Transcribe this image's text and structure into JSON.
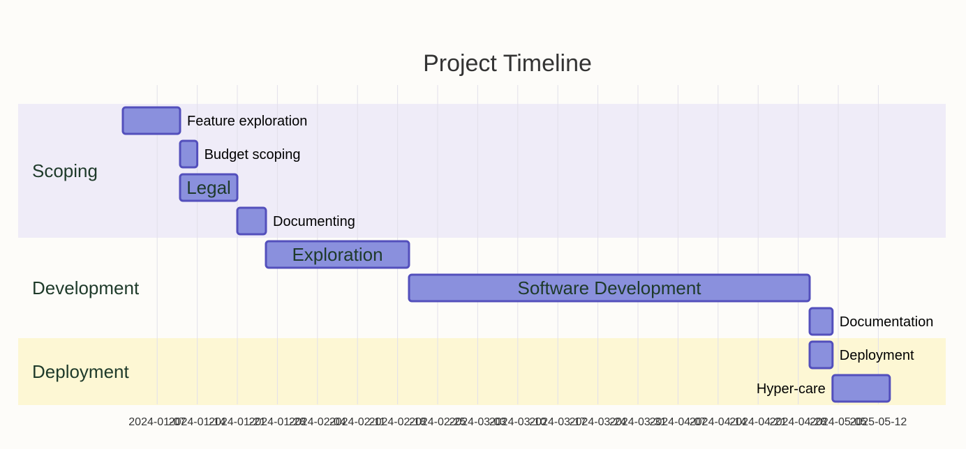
{
  "title": "Project Timeline",
  "colors": {
    "background": "#fdfcf9",
    "section_scoping_bg": "#efecf8",
    "section_development_bg": "#fdfcf9",
    "section_deployment_bg": "#fdf7d4",
    "bar_fill": "#8a90dd",
    "bar_stroke": "#534fbc",
    "section_label": "#1e3a2a",
    "grid": "#e2e0ea"
  },
  "chart_data": {
    "type": "gantt",
    "title": "Project Timeline",
    "x_axis": "date",
    "x_ticks": [
      "2024-01-07",
      "2024-01-14",
      "2024-01-21",
      "2024-01-28",
      "2024-02-04",
      "2024-02-11",
      "2024-02-18",
      "2024-02-25",
      "2024-03-03",
      "2024-03-10",
      "2024-03-17",
      "2024-03-24",
      "2024-03-31",
      "2024-04-07",
      "2024-04-14",
      "2024-04-21",
      "2024-04-28",
      "2024-05-05",
      "2024-05-12"
    ],
    "x_tick_labels": [
      "2024-01-07",
      "2024-01-14",
      "2024-01-21",
      "2024-01-28",
      "2024-02-04",
      "2024-02-11",
      "2024-02-18",
      "2024-02-25",
      "2024-03-03",
      "2024-03-10",
      "2024-03-17",
      "2024-03-24",
      "2024-03-31",
      "2024-04-07",
      "2024-04-14",
      "2024-04-21",
      "2024-04-28",
      "2024-05-05",
      "2025-05-12"
    ],
    "x_range": [
      "2024-01-01",
      "2024-05-13"
    ],
    "sections": [
      {
        "name": "Scoping",
        "tasks": [
          {
            "name": "Feature exploration",
            "start": "2024-01-01",
            "end": "2024-01-11",
            "label_inside": false
          },
          {
            "name": "Budget scoping",
            "start": "2024-01-11",
            "end": "2024-01-14",
            "label_inside": false
          },
          {
            "name": "Legal",
            "start": "2024-01-11",
            "end": "2024-01-21",
            "label_inside": true
          },
          {
            "name": "Documenting",
            "start": "2024-01-21",
            "end": "2024-01-26",
            "label_inside": false
          }
        ]
      },
      {
        "name": "Development",
        "tasks": [
          {
            "name": "Exploration",
            "start": "2024-01-26",
            "end": "2024-02-20",
            "label_inside": true
          },
          {
            "name": "Software Development",
            "start": "2024-02-20",
            "end": "2024-04-30",
            "label_inside": true
          },
          {
            "name": "Documentation",
            "start": "2024-04-30",
            "end": "2024-05-04",
            "label_inside": false
          }
        ]
      },
      {
        "name": "Deployment",
        "tasks": [
          {
            "name": "Deployment",
            "start": "2024-04-30",
            "end": "2024-05-04",
            "label_inside": false
          },
          {
            "name": "Hyper-care",
            "start": "2024-05-04",
            "end": "2024-05-14",
            "label_inside": false,
            "label_left": true
          }
        ]
      }
    ]
  }
}
